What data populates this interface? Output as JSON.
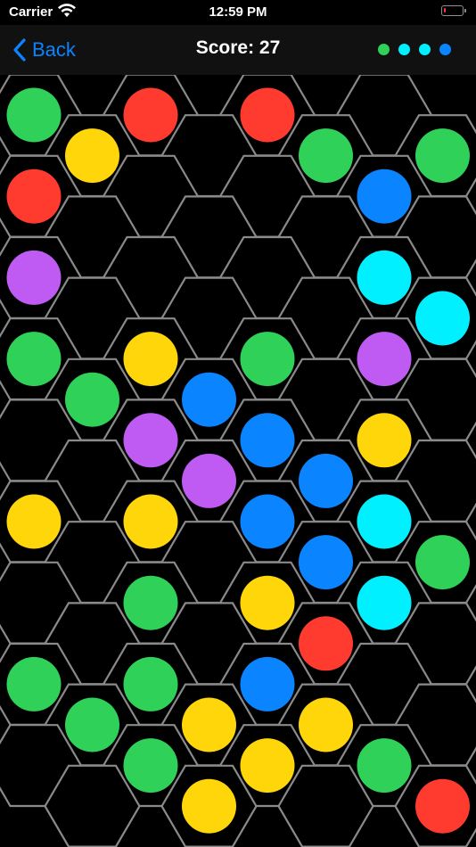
{
  "status_bar": {
    "carrier": "Carrier",
    "time": "12:59 PM",
    "wifi_icon": "wifi-icon",
    "battery_icon": "battery-low-icon",
    "battery_level": 0.12
  },
  "nav": {
    "back_label": "Back",
    "back_icon": "chevron-left-icon",
    "score_text": "Score: 27"
  },
  "colors": {
    "green": "#30d158",
    "red": "#ff3b30",
    "yellow": "#ffd60a",
    "blue": "#0a84ff",
    "cyan": "#00f0ff",
    "purple": "#bf5af2",
    "accent": "#0a84ff",
    "grid_line": "#8a8a8a",
    "background": "#000000"
  },
  "next_dots": [
    "green",
    "cyan",
    "cyan",
    "blue"
  ],
  "board": {
    "columns": 8,
    "rows": 10,
    "cells": [
      [
        "green",
        null,
        "red",
        null,
        "red",
        null,
        null,
        null
      ],
      [
        null,
        "yellow",
        null,
        null,
        null,
        "green",
        null,
        "green"
      ],
      [
        "red",
        null,
        null,
        null,
        null,
        null,
        "blue",
        null
      ],
      [
        null,
        null,
        null,
        null,
        null,
        null,
        null,
        null
      ],
      [
        "purple",
        null,
        null,
        null,
        null,
        null,
        "cyan",
        null
      ],
      [
        null,
        null,
        null,
        null,
        null,
        null,
        null,
        "cyan"
      ],
      [
        "green",
        null,
        "yellow",
        null,
        "green",
        null,
        "purple",
        null
      ],
      [
        null,
        "green",
        null,
        "blue",
        null,
        null,
        null,
        null
      ],
      [
        null,
        null,
        "purple",
        null,
        "blue",
        null,
        "yellow",
        null
      ],
      [
        null,
        null,
        null,
        "purple",
        null,
        "blue",
        null,
        null
      ],
      [
        "yellow",
        null,
        "yellow",
        null,
        "blue",
        null,
        "cyan",
        null
      ],
      [
        null,
        null,
        null,
        null,
        null,
        "blue",
        null,
        "green"
      ],
      [
        null,
        null,
        "green",
        null,
        "yellow",
        null,
        "cyan",
        null
      ],
      [
        null,
        null,
        null,
        null,
        null,
        "red",
        null,
        null
      ],
      [
        "green",
        null,
        "green",
        null,
        "blue",
        null,
        null,
        null
      ],
      [
        null,
        "green",
        null,
        "yellow",
        null,
        "yellow",
        null,
        null
      ],
      [
        null,
        null,
        "green",
        null,
        "yellow",
        null,
        "green",
        null
      ],
      [
        null,
        null,
        null,
        "yellow",
        null,
        null,
        null,
        "red"
      ]
    ]
  }
}
